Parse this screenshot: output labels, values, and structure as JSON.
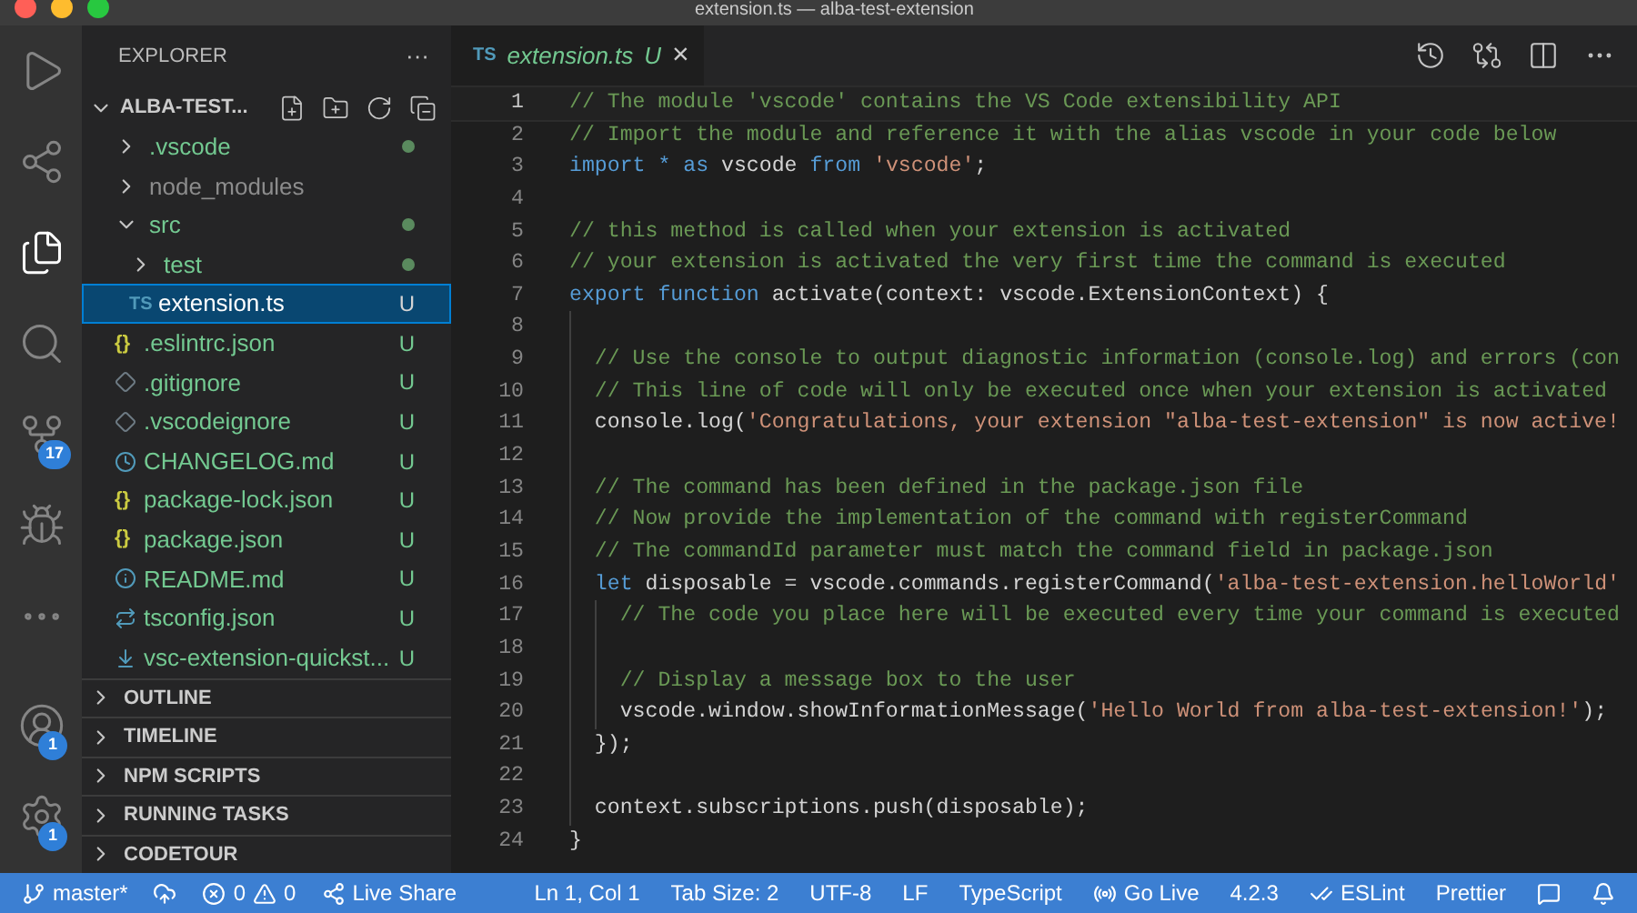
{
  "window": {
    "title": "extension.ts — alba-test-extension"
  },
  "activity_bar": [
    {
      "kind": "run",
      "selected": false
    },
    {
      "kind": "live-share",
      "selected": false
    },
    {
      "kind": "explorer",
      "selected": true
    },
    {
      "kind": "search",
      "selected": false
    },
    {
      "kind": "source-control",
      "selected": false,
      "badge": "17"
    },
    {
      "kind": "debug",
      "selected": false
    },
    {
      "kind": "more",
      "selected": false
    },
    {
      "kind": "account",
      "selected": false,
      "badge": "1"
    },
    {
      "kind": "settings",
      "selected": false,
      "badge": "1"
    }
  ],
  "sidebar": {
    "title": "EXPLORER",
    "more": "···",
    "root": {
      "label": "ALBA-TEST...",
      "expanded": true
    },
    "items": [
      {
        "label": ".vscode",
        "kind": "folder",
        "expanded": false,
        "ignored": false,
        "dot": true
      },
      {
        "label": "node_modules",
        "kind": "folder",
        "expanded": false,
        "ignored": true,
        "dot": false
      },
      {
        "label": "src",
        "kind": "folder",
        "expanded": true,
        "ignored": false,
        "dot": true,
        "children": [
          {
            "label": "test",
            "kind": "folder",
            "expanded": false,
            "ignored": false,
            "dot": true
          },
          {
            "label": "extension.ts",
            "kind": "ts",
            "icon_text": "TS",
            "status": "U",
            "selected": true,
            "ignored": false
          }
        ]
      },
      {
        "label": ".eslintrc.json",
        "kind": "json",
        "icon_text": "{}",
        "status": "U",
        "selected": false,
        "ignored": false
      },
      {
        "label": ".gitignore",
        "kind": "git",
        "status": "U",
        "selected": false,
        "ignored": false
      },
      {
        "label": ".vscodeignore",
        "kind": "git",
        "status": "U",
        "selected": false,
        "ignored": false
      },
      {
        "label": "CHANGELOG.md",
        "kind": "changelog",
        "status": "U",
        "selected": false,
        "ignored": false
      },
      {
        "label": "package-lock.json",
        "kind": "json",
        "icon_text": "{}",
        "status": "U",
        "selected": false,
        "ignored": false
      },
      {
        "label": "package.json",
        "kind": "json",
        "icon_text": "{}",
        "status": "U",
        "selected": false,
        "ignored": false
      },
      {
        "label": "README.md",
        "kind": "info",
        "status": "U",
        "selected": false,
        "ignored": false
      },
      {
        "label": "tsconfig.json",
        "kind": "tsconfig",
        "status": "U",
        "selected": false,
        "ignored": false
      },
      {
        "label": "vsc-extension-quickst...",
        "kind": "download",
        "status": "U",
        "selected": false,
        "ignored": false
      }
    ],
    "sections": [
      {
        "label": "OUTLINE",
        "expanded": false
      },
      {
        "label": "TIMELINE",
        "expanded": false
      },
      {
        "label": "NPM SCRIPTS",
        "expanded": false
      },
      {
        "label": "RUNNING TASKS",
        "expanded": false
      },
      {
        "label": "CODETOUR",
        "expanded": false
      }
    ]
  },
  "editor": {
    "tabs": [
      {
        "icon_text": "TS",
        "label": "extension.ts",
        "status": "U",
        "close": "×",
        "selected": true
      }
    ],
    "lines": [
      {
        "number": "1",
        "current": true,
        "tokens": [
          {
            "kind": "comment",
            "text": "// The module 'vscode' contains the VS Code extensibility API"
          }
        ]
      },
      {
        "number": "2",
        "current": false,
        "tokens": [
          {
            "kind": "comment",
            "text": "// Import the module and reference it with the alias vscode in your code below"
          }
        ]
      },
      {
        "number": "3",
        "current": false,
        "tokens": [
          {
            "kind": "keyword",
            "text": "import * as"
          },
          {
            "kind": "plain",
            "text": " vscode "
          },
          {
            "kind": "keyword",
            "text": "from"
          },
          {
            "kind": "string",
            "text": " 'vscode'"
          },
          {
            "kind": "plain",
            "text": ";"
          }
        ]
      },
      {
        "number": "4",
        "current": false
      },
      {
        "number": "5",
        "current": false,
        "tokens": [
          {
            "kind": "comment",
            "text": "// this method is called when your extension is activated"
          }
        ]
      },
      {
        "number": "6",
        "current": false,
        "tokens": [
          {
            "kind": "comment",
            "text": "// your extension is activated the very first time the command is executed"
          }
        ]
      },
      {
        "number": "7",
        "current": false,
        "tokens": [
          {
            "kind": "keyword",
            "text": "export function"
          },
          {
            "kind": "plain",
            "text": " activate(context: vscode.ExtensionContext) {"
          }
        ]
      },
      {
        "number": "8",
        "current": false
      },
      {
        "number": "9",
        "current": false,
        "tokens": [
          {
            "kind": "comment",
            "text": "  // Use the console to output diagnostic information (console.log) and errors (con"
          }
        ]
      },
      {
        "number": "10",
        "current": false,
        "tokens": [
          {
            "kind": "comment",
            "text": "  // This line of code will only be executed once when your extension is activated"
          }
        ]
      },
      {
        "number": "11",
        "current": false,
        "tokens": [
          {
            "kind": "plain",
            "text": "  console.log("
          },
          {
            "kind": "string",
            "text": "'Congratulations, your extension \"alba-test-extension\" is now active!"
          }
        ]
      },
      {
        "number": "12",
        "current": false
      },
      {
        "number": "13",
        "current": false,
        "tokens": [
          {
            "kind": "comment",
            "text": "  // The command has been defined in the package.json file"
          }
        ]
      },
      {
        "number": "14",
        "current": false,
        "tokens": [
          {
            "kind": "comment",
            "text": "  // Now provide the implementation of the command with registerCommand"
          }
        ]
      },
      {
        "number": "15",
        "current": false,
        "tokens": [
          {
            "kind": "comment",
            "text": "  // The commandId parameter must match the command field in package.json"
          }
        ]
      },
      {
        "number": "16",
        "current": false,
        "tokens": [
          {
            "kind": "keyword",
            "text": "  let"
          },
          {
            "kind": "plain",
            "text": " disposable = vscode.commands.registerCommand("
          },
          {
            "kind": "string",
            "text": "'alba-test-extension.helloWorld'"
          }
        ]
      },
      {
        "number": "17",
        "current": false,
        "tokens": [
          {
            "kind": "comment",
            "text": "    // The code you place here will be executed every time your command is executed"
          }
        ]
      },
      {
        "number": "18",
        "current": false
      },
      {
        "number": "19",
        "current": false,
        "tokens": [
          {
            "kind": "comment",
            "text": "    // Display a message box to the user"
          }
        ]
      },
      {
        "number": "20",
        "current": false,
        "tokens": [
          {
            "kind": "plain",
            "text": "    vscode.window.showInformationMessage("
          },
          {
            "kind": "string",
            "text": "'Hello World from alba-test-extension!'"
          },
          {
            "kind": "plain",
            "text": ");"
          }
        ]
      },
      {
        "number": "21",
        "current": false,
        "tokens": [
          {
            "kind": "plain",
            "text": "  });"
          }
        ]
      },
      {
        "number": "22",
        "current": false
      },
      {
        "number": "23",
        "current": false,
        "tokens": [
          {
            "kind": "plain",
            "text": "  context.subscriptions.push(disposable);"
          }
        ]
      },
      {
        "number": "24",
        "current": false,
        "tokens": [
          {
            "kind": "plain",
            "text": "}"
          }
        ]
      }
    ]
  },
  "status_bar": {
    "left": [
      {
        "kind": "branch",
        "text": "master*"
      },
      {
        "kind": "cloud"
      },
      {
        "kind": "error",
        "text": "0"
      },
      {
        "kind": "warning",
        "text": "0"
      },
      {
        "kind": "live-share",
        "text": "Live Share"
      }
    ],
    "right": [
      {
        "kind": "text",
        "text": "Ln 1, Col 1"
      },
      {
        "kind": "text",
        "text": "Tab Size: 2"
      },
      {
        "kind": "text",
        "text": "UTF-8"
      },
      {
        "kind": "text",
        "text": "LF"
      },
      {
        "kind": "text",
        "text": "TypeScript"
      },
      {
        "kind": "broadcast",
        "text": "Go Live"
      },
      {
        "kind": "text",
        "text": "4.2.3"
      },
      {
        "kind": "checks",
        "text": "ESLint"
      },
      {
        "kind": "text",
        "text": "Prettier"
      },
      {
        "kind": "feedback"
      },
      {
        "kind": "bell"
      }
    ]
  }
}
